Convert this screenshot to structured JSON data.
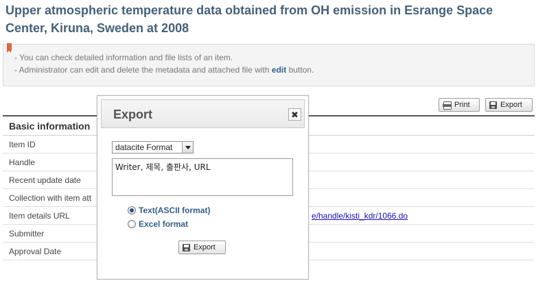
{
  "page": {
    "title": "Upper atmospheric temperature data obtained from OH emission in Esrange Space Center, Kiruna, Sweden at 2008"
  },
  "notice": {
    "line1": "- You can check detailed information and file lists of an item.",
    "line2_prefix": "- Administrator can edit and delete the metadata and attached file with ",
    "line2_bold": "edit",
    "line2_suffix": " button."
  },
  "toolbar": {
    "print_label": "Print",
    "export_label": "Export"
  },
  "section": {
    "title": "Basic information"
  },
  "rows": [
    {
      "label": "Item ID",
      "value": ""
    },
    {
      "label": "Handle",
      "value": ""
    },
    {
      "label": "Recent update date",
      "value": ""
    },
    {
      "label": "Collection with item att",
      "value": ""
    },
    {
      "label": "Item details URL",
      "value": "e/handle/kisti_kdr/1066.do"
    },
    {
      "label": "Submitter",
      "value": ""
    },
    {
      "label": "Approval Date",
      "value": ""
    }
  ],
  "modal": {
    "title": "Export",
    "close_symbol": "✖",
    "format_selected": "datacite Format",
    "fields_text": "Writer, 제목, 출판사, URL",
    "options": [
      {
        "label": "Text(ASCII format)",
        "checked": true
      },
      {
        "label": "Excel format",
        "checked": false
      }
    ],
    "export_label": "Export"
  },
  "icons": {
    "print": "printer-icon",
    "export": "disk-icon",
    "bookmark": "bookmark-icon",
    "close": "close-icon"
  },
  "colors": {
    "title": "#466178",
    "link": "#1a0dab",
    "bookmark": "#d9674a",
    "accent": "#335e87"
  }
}
